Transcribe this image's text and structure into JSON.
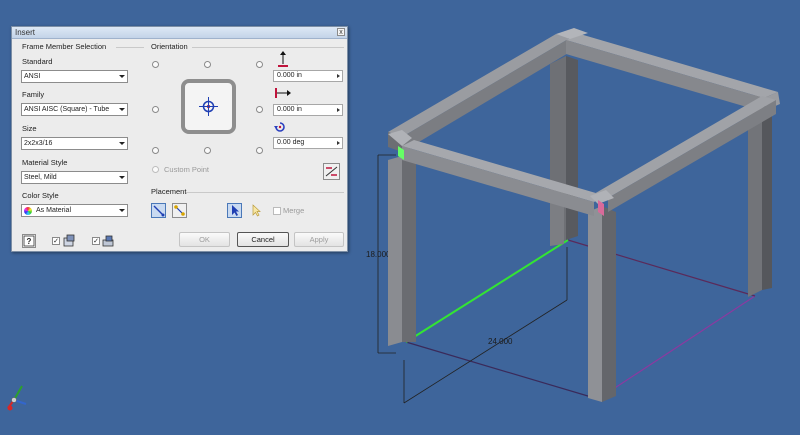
{
  "dialog": {
    "title": "Insert",
    "close_label": "x",
    "frame_member_selection": "Frame Member Selection",
    "standard": {
      "label": "Standard",
      "value": "ANSI"
    },
    "family": {
      "label": "Family",
      "value": "ANSI AISC (Square) - Tube"
    },
    "size": {
      "label": "Size",
      "value": "2x2x3/16"
    },
    "material_style": {
      "label": "Material Style",
      "value": "Steel, Mild"
    },
    "color_style": {
      "label": "Color Style",
      "value": "As Material"
    },
    "orientation": {
      "label": "Orientation",
      "vertical_offset": "0.000 in",
      "horizontal_offset": "0.000 in",
      "rotation": "0.00 deg",
      "custom_point": "Custom Point"
    },
    "placement": {
      "label": "Placement",
      "merge_label": "Merge"
    },
    "buttons": {
      "ok": "OK",
      "cancel": "Cancel",
      "apply": "Apply"
    },
    "icons": {
      "help": "help-icon",
      "display": "display-icon",
      "preview": "preview-icon"
    }
  },
  "viewport": {
    "dimension_height": "18.000",
    "dimension_width": "24.000",
    "colors": {
      "background": "#3e659b",
      "tube": "#7d7f85",
      "selected_edge": "#33e533",
      "sketch_line": "#7a2b6a"
    }
  }
}
